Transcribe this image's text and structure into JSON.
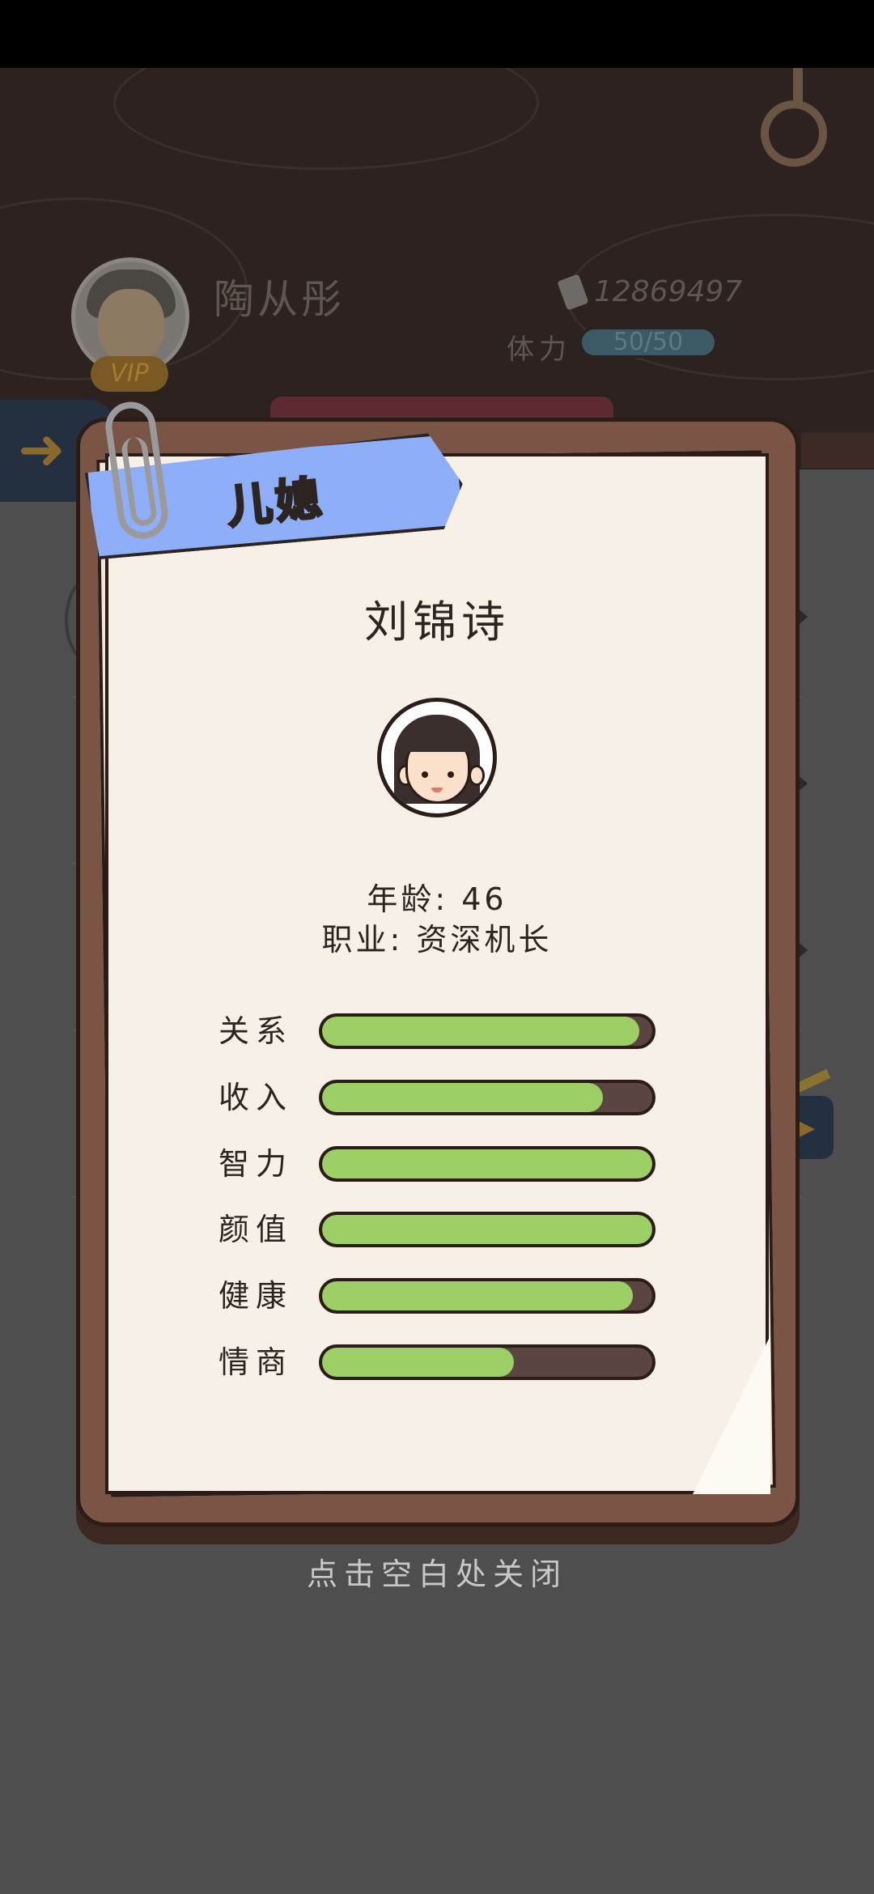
{
  "header": {
    "player_name": "陶从彤",
    "vip": "VIP",
    "money": "12869497",
    "stamina_label": "体力",
    "stamina_value": "50/50"
  },
  "modal": {
    "relation_tag": "儿媳",
    "name": "刘锦诗",
    "age_line": "年龄: 46",
    "job_line": "职业: 资深机长",
    "stats": [
      {
        "label": "关系",
        "value": 0.96
      },
      {
        "label": "收入",
        "value": 0.85
      },
      {
        "label": "智力",
        "value": 1.0
      },
      {
        "label": "颜值",
        "value": 1.0
      },
      {
        "label": "健康",
        "value": 0.94
      },
      {
        "label": "情商",
        "value": 0.58
      }
    ]
  },
  "close_hint": "点击空白处关闭",
  "colors": {
    "ribbon": "#8eaef8",
    "stat_fill": "#9cd067",
    "stat_track": "#5a4541",
    "card": "#7a5445",
    "paper": "#f7f0e6"
  },
  "icons": [
    "money-icon",
    "back-arrow-icon",
    "paperclip-icon",
    "hanging-ring-icon"
  ]
}
